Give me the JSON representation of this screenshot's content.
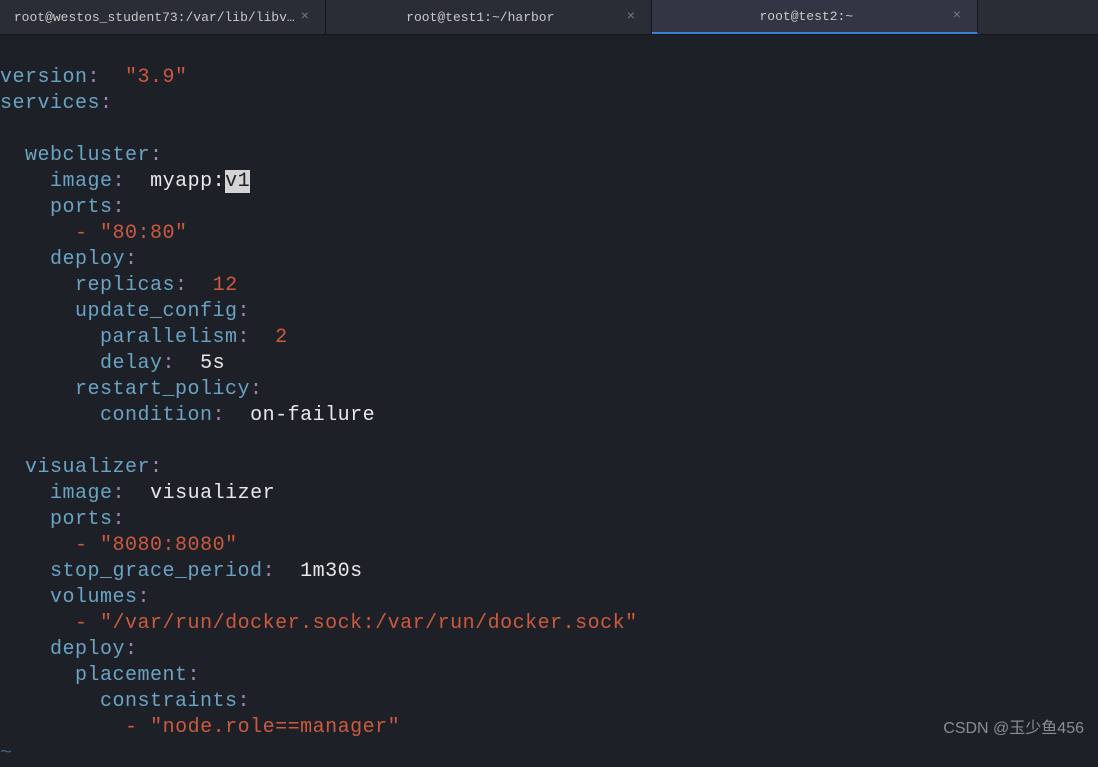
{
  "tabs": [
    {
      "title": "root@westos_student73:/var/lib/libv…",
      "active": false
    },
    {
      "title": "root@test1:~/harbor",
      "active": false
    },
    {
      "title": "root@test2:~",
      "active": true
    }
  ],
  "yaml": {
    "version_key": "version",
    "version_val": "\"3.9\"",
    "services_key": "services",
    "webcluster": {
      "name": "webcluster",
      "image_key": "image",
      "image_val_prefix": "myapp:",
      "image_val_cursor": "v1",
      "ports_key": "ports",
      "ports_val": "\"80:80\"",
      "deploy_key": "deploy",
      "replicas_key": "replicas",
      "replicas_val": "12",
      "update_config_key": "update_config",
      "parallelism_key": "parallelism",
      "parallelism_val": "2",
      "delay_key": "delay",
      "delay_val": "5s",
      "restart_policy_key": "restart_policy",
      "condition_key": "condition",
      "condition_val": "on-failure"
    },
    "visualizer": {
      "name": "visualizer",
      "image_key": "image",
      "image_val": "visualizer",
      "ports_key": "ports",
      "ports_val": "\"8080:8080\"",
      "stop_grace_key": "stop_grace_period",
      "stop_grace_val": "1m30s",
      "volumes_key": "volumes",
      "volumes_val": "\"/var/run/docker.sock:/var/run/docker.sock\"",
      "deploy_key": "deploy",
      "placement_key": "placement",
      "constraints_key": "constraints",
      "constraints_val": "\"node.role==manager\""
    }
  },
  "tilde": "~",
  "watermark": "CSDN @玉少鱼456"
}
